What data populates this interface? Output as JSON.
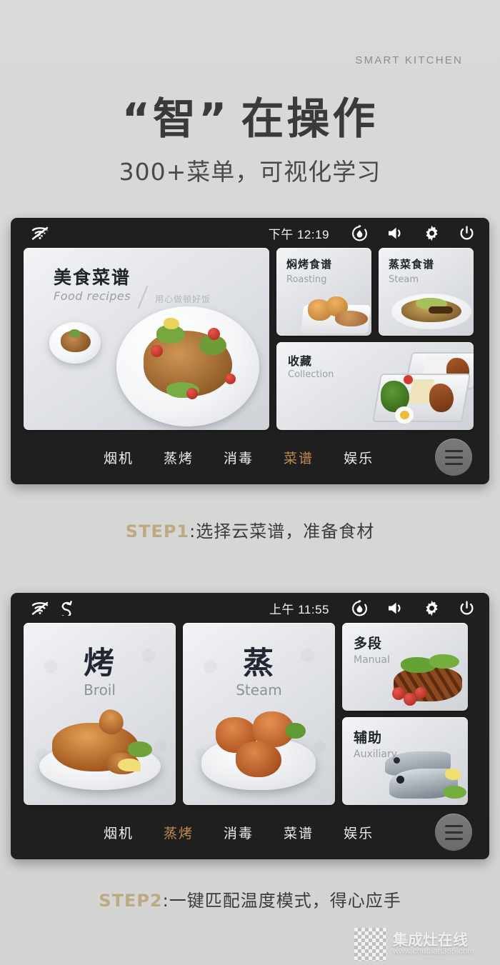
{
  "hero": {
    "eyebrow": "SMART  KITCHEN",
    "headline_left": "“智”",
    "headline_right": "在操作",
    "subline": "300+菜单，可视化学习"
  },
  "colors": {
    "page_background": "#d8d8d6",
    "device_frame": "#1f1f1f",
    "nav_active": "#c08a50",
    "step_label": "#bda982",
    "headline_text": "#3a3a3a"
  },
  "screen1": {
    "statusbar": {
      "wifi_icon": "wifi-off-icon",
      "time": "下午 12:19",
      "timer_icon": "timer-droplet-icon",
      "volume_icon": "volume-icon",
      "settings_icon": "gear-icon",
      "power_icon": "power-icon"
    },
    "cards": {
      "main": {
        "title": "美食菜谱",
        "subtitle": "Food recipes",
        "note": "用心做顿好饭"
      },
      "roasting": {
        "title": "焖烤食谱",
        "subtitle": "Roasting"
      },
      "steam": {
        "title": "蒸菜食谱",
        "subtitle": "Steam"
      },
      "collection": {
        "title": "收藏",
        "subtitle": "Collection"
      }
    },
    "nav": [
      {
        "label": "烟机",
        "active": false
      },
      {
        "label": "蒸烤",
        "active": false
      },
      {
        "label": "消毒",
        "active": false
      },
      {
        "label": "菜谱",
        "active": true
      },
      {
        "label": "娱乐",
        "active": false
      }
    ],
    "menu_icon": "hamburger-menu-icon"
  },
  "caption1": {
    "step": "STEP1",
    "text": ":选择云菜谱，准备食材"
  },
  "screen2": {
    "statusbar": {
      "wifi_icon": "wifi-off-icon",
      "sync_icon": "sync-refresh-icon",
      "time": "上午 11:55",
      "timer_icon": "timer-droplet-icon",
      "volume_icon": "volume-icon",
      "settings_icon": "gear-icon",
      "power_icon": "power-icon"
    },
    "cards": {
      "broil": {
        "title": "烤",
        "subtitle": "Broil"
      },
      "steam": {
        "title": "蒸",
        "subtitle": "Steam"
      },
      "manual": {
        "title": "多段",
        "subtitle": "Manual"
      },
      "auxiliary": {
        "title": "辅助",
        "subtitle": "Auxiliary"
      }
    },
    "nav": [
      {
        "label": "烟机",
        "active": false
      },
      {
        "label": "蒸烤",
        "active": true
      },
      {
        "label": "消毒",
        "active": false
      },
      {
        "label": "菜谱",
        "active": false
      },
      {
        "label": "娱乐",
        "active": false
      }
    ],
    "menu_icon": "hamburger-menu-icon"
  },
  "caption2": {
    "step": "STEP2",
    "text": ":一键匹配温度模式，得心应手"
  },
  "watermark": {
    "name": "集成灶在线",
    "url": "www.chudian365.com"
  }
}
